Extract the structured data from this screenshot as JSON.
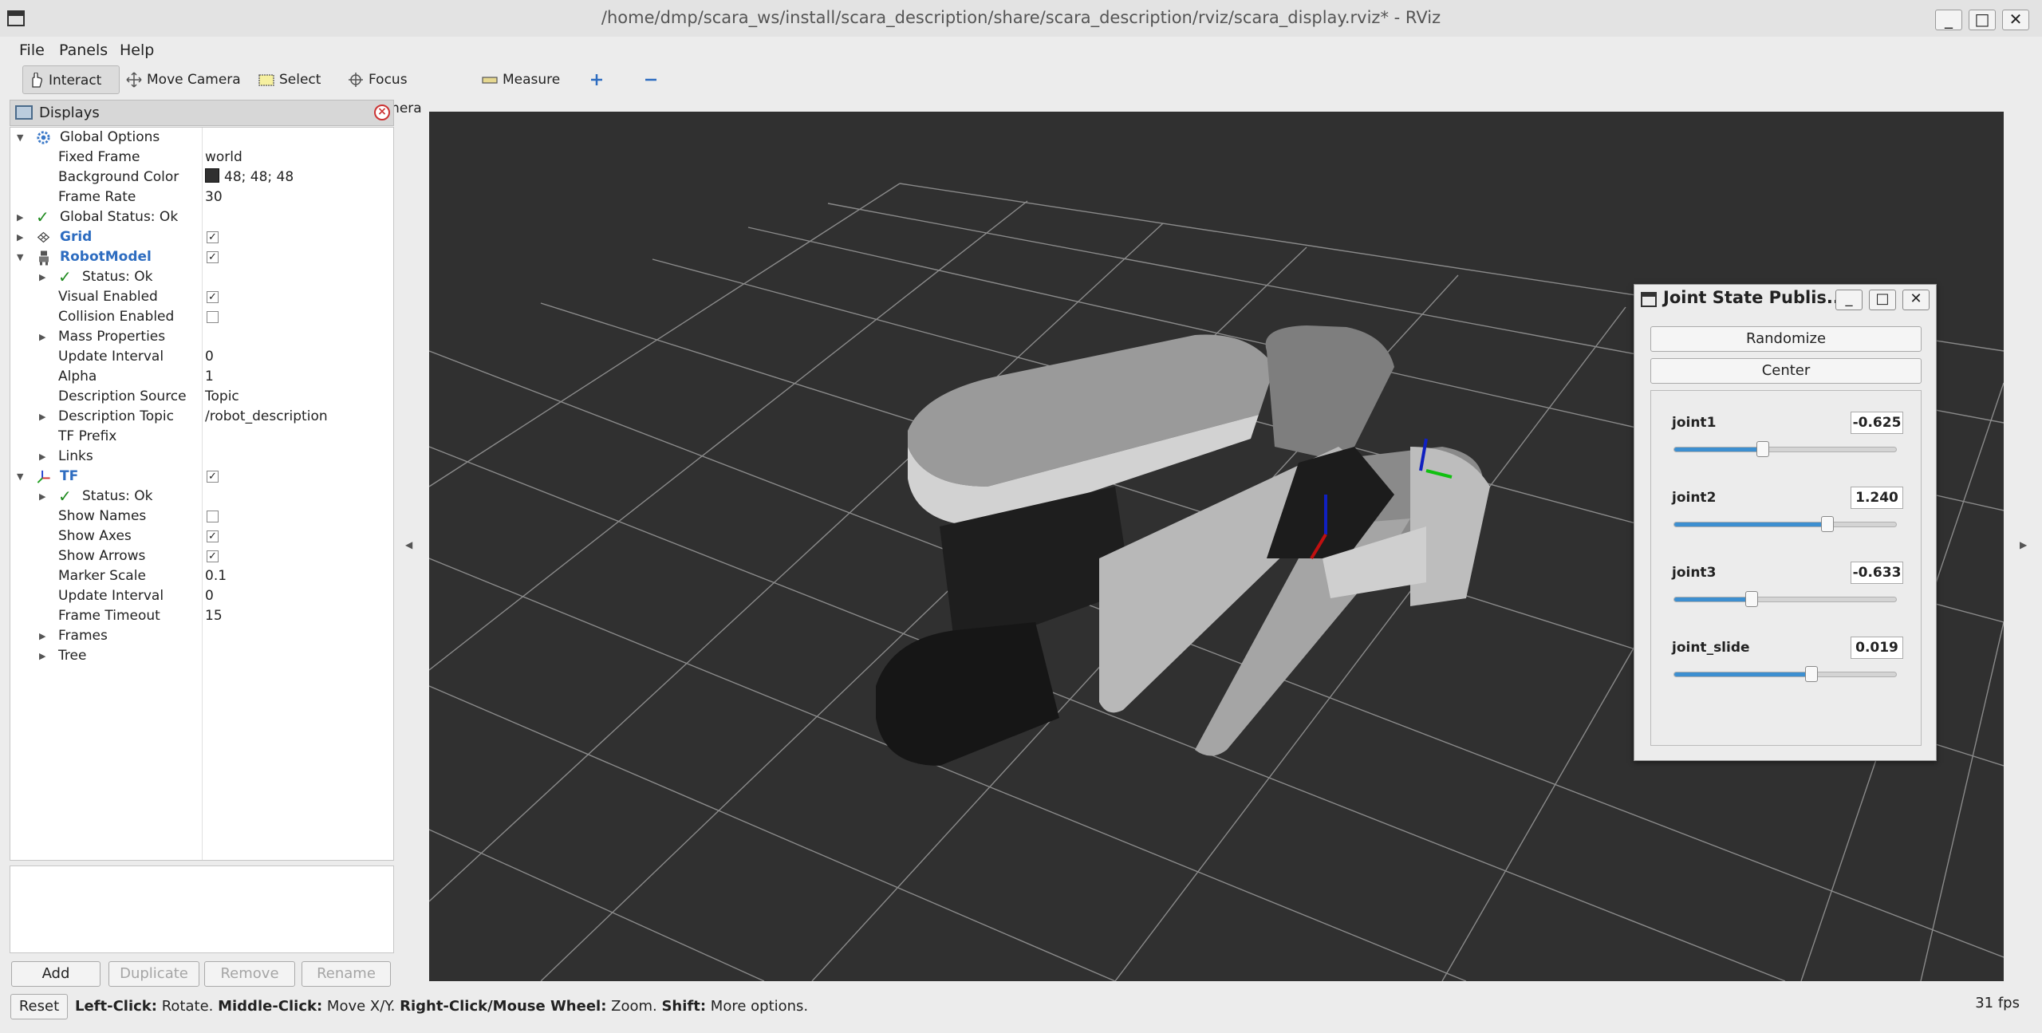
{
  "window": {
    "title": "/home/dmp/scara_ws/install/scara_description/share/scara_description/rviz/scara_display.rviz* - RViz"
  },
  "menu": {
    "file": "File",
    "panels": "Panels",
    "help": "Help"
  },
  "toolbar": {
    "interact": "Interact",
    "move_camera": "Move Camera",
    "select": "Select",
    "focus_camera": "Focus Camera",
    "measure": "Measure"
  },
  "displays": {
    "title": "Displays",
    "global_options": "Global Options",
    "fixed_frame_key": "Fixed Frame",
    "fixed_frame_val": "world",
    "bg_color_key": "Background Color",
    "bg_color_val": "48; 48; 48",
    "frame_rate_key": "Frame Rate",
    "frame_rate_val": "30",
    "global_status": "Global Status: Ok",
    "grid": "Grid",
    "robot_model": "RobotModel",
    "rm_status": "Status: Ok",
    "visual_enabled": "Visual Enabled",
    "collision_enabled": "Collision Enabled",
    "mass_properties": "Mass Properties",
    "update_interval_key": "Update Interval",
    "update_interval_val": "0",
    "alpha_key": "Alpha",
    "alpha_val": "1",
    "desc_source_key": "Description Source",
    "desc_source_val": "Topic",
    "desc_topic_key": "Description Topic",
    "desc_topic_val": "/robot_description",
    "tf_prefix": "TF Prefix",
    "links": "Links",
    "tf": "TF",
    "tf_status": "Status: Ok",
    "show_names": "Show Names",
    "show_axes": "Show Axes",
    "show_arrows": "Show Arrows",
    "marker_scale_key": "Marker Scale",
    "marker_scale_val": "0.1",
    "tf_update_interval_key": "Update Interval",
    "tf_update_interval_val": "0",
    "frame_timeout_key": "Frame Timeout",
    "frame_timeout_val": "15",
    "frames": "Frames",
    "tree": "Tree"
  },
  "panel_buttons": {
    "add": "Add",
    "duplicate": "Duplicate",
    "remove": "Remove",
    "rename": "Rename"
  },
  "status": {
    "reset": "Reset",
    "left_click": "Left-Click:",
    "left_click_desc": " Rotate. ",
    "middle_click": "Middle-Click:",
    "middle_click_desc": " Move X/Y. ",
    "right_click": "Right-Click/Mouse Wheel:",
    "right_click_desc": " Zoom. ",
    "shift": "Shift:",
    "shift_desc": " More options.",
    "fps": "31 fps"
  },
  "joint_state_publisher": {
    "title": "Joint State Publis...",
    "randomize": "Randomize",
    "center": "Center",
    "joints": [
      {
        "name": "joint1",
        "value": "-0.625",
        "fraction": 0.4
      },
      {
        "name": "joint2",
        "value": "1.240",
        "fraction": 0.69
      },
      {
        "name": "joint3",
        "value": "-0.633",
        "fraction": 0.35
      },
      {
        "name": "joint_slide",
        "value": "0.019",
        "fraction": 0.62
      }
    ]
  },
  "colors": {
    "viewport_bg": "#303030",
    "accent": "#2d6cc0",
    "slider": "#3d8fd0"
  }
}
